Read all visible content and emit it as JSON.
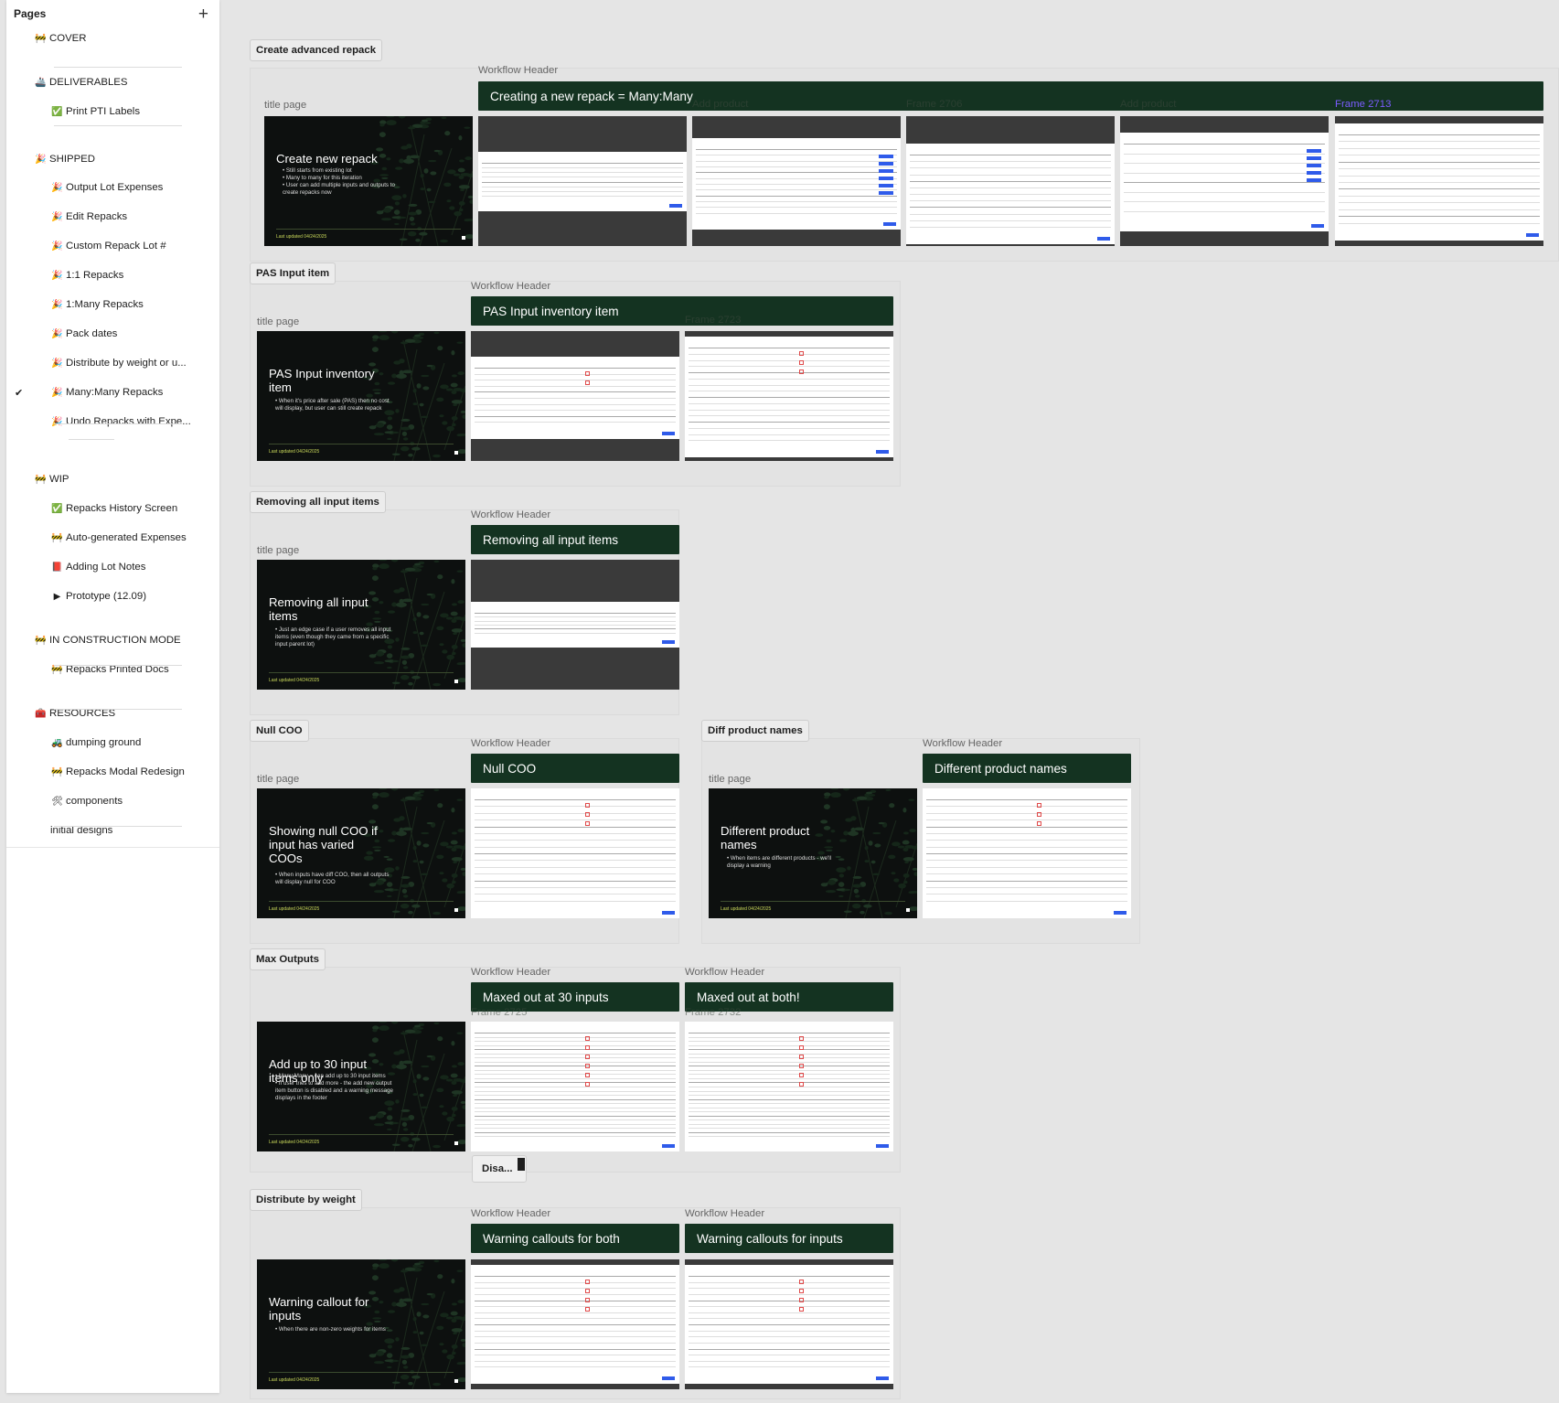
{
  "sidebar": {
    "title": "Pages",
    "add_icon": "plus-icon",
    "items": [
      {
        "emoji": "🚧",
        "label": "COVER",
        "level": 0
      },
      {
        "emoji": "🚢",
        "label": "DELIVERABLES",
        "level": 0
      },
      {
        "emoji": "✅",
        "label": "Print PTI Labels",
        "level": 1
      },
      {
        "emoji": "🎉",
        "label": "SHIPPED",
        "level": 0
      },
      {
        "emoji": "🎉",
        "label": "Output Lot Expenses",
        "level": 1
      },
      {
        "emoji": "🎉",
        "label": "Edit Repacks",
        "level": 1
      },
      {
        "emoji": "🎉",
        "label": "Custom Repack Lot #",
        "level": 1
      },
      {
        "emoji": "🎉",
        "label": "1:1 Repacks",
        "level": 1
      },
      {
        "emoji": "🎉",
        "label": "1:Many Repacks",
        "level": 1
      },
      {
        "emoji": "🎉",
        "label": "Pack dates",
        "level": 1
      },
      {
        "emoji": "🎉",
        "label": "Distribute by weight or u...",
        "level": 1
      },
      {
        "emoji": "🎉",
        "label": "Many:Many Repacks",
        "level": 1,
        "current": true
      },
      {
        "emoji": "🎉",
        "label": "Undo Repacks with Expe...",
        "level": 1
      },
      {
        "emoji": "🚧",
        "label": "WIP",
        "level": 0
      },
      {
        "emoji": "✅",
        "label": "Repacks History Screen",
        "level": 1
      },
      {
        "emoji": "🚧",
        "label": "Auto-generated Expenses",
        "level": 1
      },
      {
        "emoji": "📕",
        "label": "Adding Lot Notes",
        "level": 1
      },
      {
        "emoji": "▶",
        "label": "Prototype (12.09)",
        "level": 1
      },
      {
        "emoji": "🚧",
        "label": "IN CONSTRUCTION MODE",
        "level": 0
      },
      {
        "emoji": "🚧",
        "label": "Repacks Printed Docs",
        "level": 1
      },
      {
        "emoji": "🧰",
        "label": "RESOURCES",
        "level": 0
      },
      {
        "emoji": "🚜",
        "label": "dumping ground",
        "level": 1
      },
      {
        "emoji": "🚧",
        "label": "Repacks Modal Redesign",
        "level": 1
      },
      {
        "emoji": "🛠",
        "label": "components",
        "level": 1
      },
      {
        "emoji": "",
        "label": "initial designs",
        "level": 1
      }
    ],
    "check_mark": "✔"
  },
  "canvas": {
    "sections": [
      {
        "label": "Create advanced repack",
        "title_label": "title page",
        "workflow_label": "Workflow Header",
        "header": "Creating a new repack = Many:Many",
        "card_title": "Create new repack",
        "card_bullets": [
          "Still starts from existing lot",
          "Many to many for this iteration",
          "User can add multiple inputs and outputs to create repacks now"
        ],
        "card_updated": "Last updated 04/24/2025",
        "frame_labels": [
          "Add product",
          "Frame 2706",
          "Add product",
          "Frame 2713"
        ]
      },
      {
        "label": "PAS Input item",
        "title_label": "title page",
        "workflow_label": "Workflow Header",
        "header": "PAS Input inventory item",
        "card_title": "PAS Input inventory item",
        "card_bullets": [
          "When it's price after sale (PAS) then no cost will display, but user can still create repack"
        ],
        "card_updated": "Last updated 04/24/2025",
        "frame_labels": [
          "Frame 2723"
        ]
      },
      {
        "label": "Removing all input items",
        "title_label": "title page",
        "workflow_label": "Workflow Header",
        "header": "Removing all input items",
        "card_title": "Removing all input items",
        "card_bullets": [
          "Just an edge case if a user removes all input items (even though they came from a specific input parent lot)"
        ],
        "card_updated": "Last updated 04/24/2025"
      },
      {
        "label": "Null COO",
        "title_label": "title page",
        "workflow_label": "Workflow Header",
        "header": "Null COO",
        "card_title": "Showing null COO if input has varied COOs",
        "card_bullets": [
          "When inputs have diff COO, then all outputs will display null for COO"
        ],
        "card_updated": "Last updated 04/24/2025"
      },
      {
        "label": "Diff product names",
        "title_label": "title page",
        "workflow_label": "Workflow Header",
        "header": "Different product names",
        "card_title": "Different product names",
        "card_bullets": [
          "When items are different products - we'll display a warning"
        ],
        "card_updated": "Last updated 04/24/2025"
      },
      {
        "label": "Max Outputs",
        "workflow_label": "Workflow Header",
        "workflow_label_2": "Workflow Header",
        "header": "Maxed out at 30 inputs",
        "header_2": "Maxed out at both!",
        "card_title": "Add up to 30 input items only",
        "card_bullets": [
          "Many:Many = can add up to 30 input items",
          "If user tries to add more - the add new output item button is disabled and a warning message displays in the footer"
        ],
        "card_updated": "Last updated 04/24/2025",
        "frame_labels": [
          "Frame 2725",
          "Frame 2732"
        ],
        "tip": "Disa..."
      },
      {
        "label": "Distribute by weight",
        "workflow_label": "Workflow Header",
        "workflow_label_2": "Workflow Header",
        "header": "Warning callouts for both",
        "header_2": "Warning callouts for inputs",
        "card_title": "Warning callout for inputs",
        "card_bullets": [
          "When there are non-zero weights for items"
        ],
        "card_updated": "Last updated 04/24/2025"
      }
    ]
  },
  "colors": {
    "header_green": "#143321",
    "card_black": "#0d100f",
    "accent_blue": "#2f5bea",
    "frame_purple": "#7b5cff",
    "canvas_bg": "#e5e5e5"
  }
}
